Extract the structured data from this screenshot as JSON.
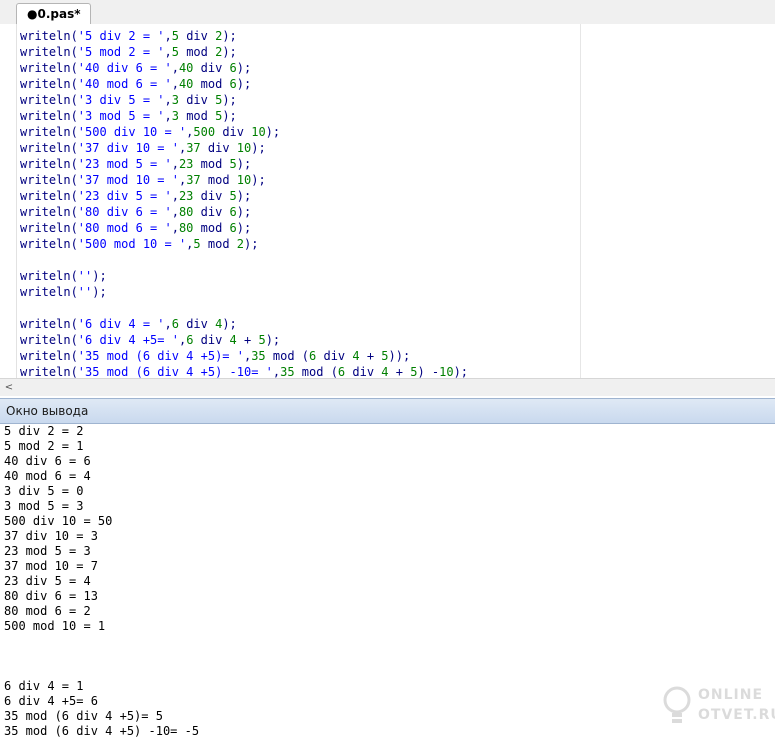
{
  "tab": {
    "label": "●0.pas*"
  },
  "editor": {
    "lines": [
      [
        [
          "kw",
          "writeln("
        ],
        [
          "str",
          "'5 div 2 = '"
        ],
        [
          "op",
          ","
        ],
        [
          "num",
          "5"
        ],
        [
          "kw",
          " div "
        ],
        [
          "num",
          "2"
        ],
        [
          "op",
          ");"
        ]
      ],
      [
        [
          "kw",
          "writeln("
        ],
        [
          "str",
          "'5 mod 2 = '"
        ],
        [
          "op",
          ","
        ],
        [
          "num",
          "5"
        ],
        [
          "kw",
          " mod "
        ],
        [
          "num",
          "2"
        ],
        [
          "op",
          ");"
        ]
      ],
      [
        [
          "kw",
          "writeln("
        ],
        [
          "str",
          "'40 div 6 = '"
        ],
        [
          "op",
          ","
        ],
        [
          "num",
          "40"
        ],
        [
          "kw",
          " div "
        ],
        [
          "num",
          "6"
        ],
        [
          "op",
          ");"
        ]
      ],
      [
        [
          "kw",
          "writeln("
        ],
        [
          "str",
          "'40 mod 6 = '"
        ],
        [
          "op",
          ","
        ],
        [
          "num",
          "40"
        ],
        [
          "kw",
          " mod "
        ],
        [
          "num",
          "6"
        ],
        [
          "op",
          ");"
        ]
      ],
      [
        [
          "kw",
          "writeln("
        ],
        [
          "str",
          "'3 div 5 = '"
        ],
        [
          "op",
          ","
        ],
        [
          "num",
          "3"
        ],
        [
          "kw",
          " div "
        ],
        [
          "num",
          "5"
        ],
        [
          "op",
          ");"
        ]
      ],
      [
        [
          "kw",
          "writeln("
        ],
        [
          "str",
          "'3 mod 5 = '"
        ],
        [
          "op",
          ","
        ],
        [
          "num",
          "3"
        ],
        [
          "kw",
          " mod "
        ],
        [
          "num",
          "5"
        ],
        [
          "op",
          ");"
        ]
      ],
      [
        [
          "kw",
          "writeln("
        ],
        [
          "str",
          "'500 div 10 = '"
        ],
        [
          "op",
          ","
        ],
        [
          "num",
          "500"
        ],
        [
          "kw",
          " div "
        ],
        [
          "num",
          "10"
        ],
        [
          "op",
          ");"
        ]
      ],
      [
        [
          "kw",
          "writeln("
        ],
        [
          "str",
          "'37 div 10 = '"
        ],
        [
          "op",
          ","
        ],
        [
          "num",
          "37"
        ],
        [
          "kw",
          " div "
        ],
        [
          "num",
          "10"
        ],
        [
          "op",
          ");"
        ]
      ],
      [
        [
          "kw",
          "writeln("
        ],
        [
          "str",
          "'23 mod 5 = '"
        ],
        [
          "op",
          ","
        ],
        [
          "num",
          "23"
        ],
        [
          "kw",
          " mod "
        ],
        [
          "num",
          "5"
        ],
        [
          "op",
          ");"
        ]
      ],
      [
        [
          "kw",
          "writeln("
        ],
        [
          "str",
          "'37 mod 10 = '"
        ],
        [
          "op",
          ","
        ],
        [
          "num",
          "37"
        ],
        [
          "kw",
          " mod "
        ],
        [
          "num",
          "10"
        ],
        [
          "op",
          ");"
        ]
      ],
      [
        [
          "kw",
          "writeln("
        ],
        [
          "str",
          "'23 div 5 = '"
        ],
        [
          "op",
          ","
        ],
        [
          "num",
          "23"
        ],
        [
          "kw",
          " div "
        ],
        [
          "num",
          "5"
        ],
        [
          "op",
          ");"
        ]
      ],
      [
        [
          "kw",
          "writeln("
        ],
        [
          "str",
          "'80 div 6 = '"
        ],
        [
          "op",
          ","
        ],
        [
          "num",
          "80"
        ],
        [
          "kw",
          " div "
        ],
        [
          "num",
          "6"
        ],
        [
          "op",
          ");"
        ]
      ],
      [
        [
          "kw",
          "writeln("
        ],
        [
          "str",
          "'80 mod 6 = '"
        ],
        [
          "op",
          ","
        ],
        [
          "num",
          "80"
        ],
        [
          "kw",
          " mod "
        ],
        [
          "num",
          "6"
        ],
        [
          "op",
          ");"
        ]
      ],
      [
        [
          "kw",
          "writeln("
        ],
        [
          "str",
          "'500 mod 10 = '"
        ],
        [
          "op",
          ","
        ],
        [
          "num",
          "5"
        ],
        [
          "kw",
          " mod "
        ],
        [
          "num",
          "2"
        ],
        [
          "op",
          ");"
        ]
      ],
      [],
      [
        [
          "kw",
          "writeln("
        ],
        [
          "str",
          "''"
        ],
        [
          "op",
          ");"
        ]
      ],
      [
        [
          "kw",
          "writeln("
        ],
        [
          "str",
          "''"
        ],
        [
          "op",
          ");"
        ]
      ],
      [],
      [
        [
          "kw",
          "writeln("
        ],
        [
          "str",
          "'6 div 4 = '"
        ],
        [
          "op",
          ","
        ],
        [
          "num",
          "6"
        ],
        [
          "kw",
          " div "
        ],
        [
          "num",
          "4"
        ],
        [
          "op",
          ");"
        ]
      ],
      [
        [
          "kw",
          "writeln("
        ],
        [
          "str",
          "'6 div 4 +5= '"
        ],
        [
          "op",
          ","
        ],
        [
          "num",
          "6"
        ],
        [
          "kw",
          " div "
        ],
        [
          "num",
          "4"
        ],
        [
          "op",
          " + "
        ],
        [
          "num",
          "5"
        ],
        [
          "op",
          ");"
        ]
      ],
      [
        [
          "kw",
          "writeln("
        ],
        [
          "str",
          "'35 mod (6 div 4 +5)= '"
        ],
        [
          "op",
          ","
        ],
        [
          "num",
          "35"
        ],
        [
          "kw",
          " mod "
        ],
        [
          "op",
          "("
        ],
        [
          "num",
          "6"
        ],
        [
          "kw",
          " div "
        ],
        [
          "num",
          "4"
        ],
        [
          "op",
          " + "
        ],
        [
          "num",
          "5"
        ],
        [
          "op",
          "));"
        ]
      ],
      [
        [
          "kw",
          "writeln("
        ],
        [
          "str",
          "'35 mod (6 div 4 +5) -10= '"
        ],
        [
          "op",
          ","
        ],
        [
          "num",
          "35"
        ],
        [
          "kw",
          " mod "
        ],
        [
          "op",
          "("
        ],
        [
          "num",
          "6"
        ],
        [
          "kw",
          " div "
        ],
        [
          "num",
          "4"
        ],
        [
          "op",
          " + "
        ],
        [
          "num",
          "5"
        ],
        [
          "op",
          ") -"
        ],
        [
          "num",
          "10"
        ],
        [
          "op",
          ");"
        ]
      ]
    ]
  },
  "output_panel": {
    "title": "Окно вывода",
    "lines": [
      "5 div 2 = 2",
      "5 mod 2 = 1",
      "40 div 6 = 6",
      "40 mod 6 = 4",
      "3 div 5 = 0",
      "3 mod 5 = 3",
      "500 div 10 = 50",
      "37 div 10 = 3",
      "23 mod 5 = 3",
      "37 mod 10 = 7",
      "23 div 5 = 4",
      "80 div 6 = 13",
      "80 mod 6 = 2",
      "500 mod 10 = 1",
      "",
      "",
      "",
      "6 div 4 = 1",
      "6 div 4 +5= 6",
      "35 mod (6 div 4 +5)= 5",
      "35 mod (6 div 4 +5) -10= -5"
    ]
  },
  "scrollbar": {
    "left_arrow": "<"
  },
  "watermark": {
    "line1": "ONLINE",
    "line2": "OTVET.RU"
  },
  "colors": {
    "keyword": "#000080",
    "string": "#0000ff",
    "number": "#008000",
    "panel_header": "#c9d9ee"
  }
}
